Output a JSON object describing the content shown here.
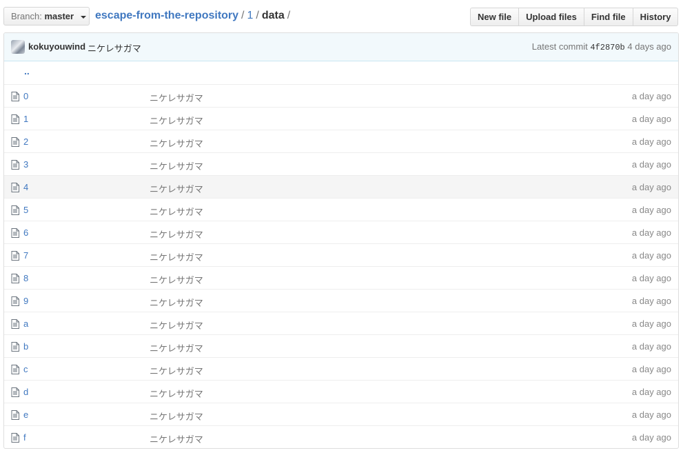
{
  "branch": {
    "prefix": "Branch:",
    "name": "master"
  },
  "breadcrumb": {
    "repo": "escape-from-the-repository",
    "crumb1": "1",
    "current": "data",
    "sep": "/"
  },
  "actions": {
    "new_file": "New file",
    "upload_files": "Upload files",
    "find_file": "Find file",
    "history": "History"
  },
  "commit": {
    "author": "kokuyouwind",
    "message": "ニケレサガマ",
    "latest_label": "Latest commit",
    "sha": "4f2870b",
    "age": "4 days ago"
  },
  "parent_dir": "..",
  "files": [
    {
      "name": "0",
      "message": "ニケレサガマ",
      "age": "a day ago"
    },
    {
      "name": "1",
      "message": "ニケレサガマ",
      "age": "a day ago"
    },
    {
      "name": "2",
      "message": "ニケレサガマ",
      "age": "a day ago"
    },
    {
      "name": "3",
      "message": "ニケレサガマ",
      "age": "a day ago"
    },
    {
      "name": "4",
      "message": "ニケレサガマ",
      "age": "a day ago"
    },
    {
      "name": "5",
      "message": "ニケレサガマ",
      "age": "a day ago"
    },
    {
      "name": "6",
      "message": "ニケレサガマ",
      "age": "a day ago"
    },
    {
      "name": "7",
      "message": "ニケレサガマ",
      "age": "a day ago"
    },
    {
      "name": "8",
      "message": "ニケレサガマ",
      "age": "a day ago"
    },
    {
      "name": "9",
      "message": "ニケレサガマ",
      "age": "a day ago"
    },
    {
      "name": "a",
      "message": "ニケレサガマ",
      "age": "a day ago"
    },
    {
      "name": "b",
      "message": "ニケレサガマ",
      "age": "a day ago"
    },
    {
      "name": "c",
      "message": "ニケレサガマ",
      "age": "a day ago"
    },
    {
      "name": "d",
      "message": "ニケレサガマ",
      "age": "a day ago"
    },
    {
      "name": "e",
      "message": "ニケレサガマ",
      "age": "a day ago"
    },
    {
      "name": "f",
      "message": "ニケレサガマ",
      "age": "a day ago"
    }
  ],
  "icons": {
    "file": "file-text-icon",
    "caret": "caret-down-icon"
  }
}
